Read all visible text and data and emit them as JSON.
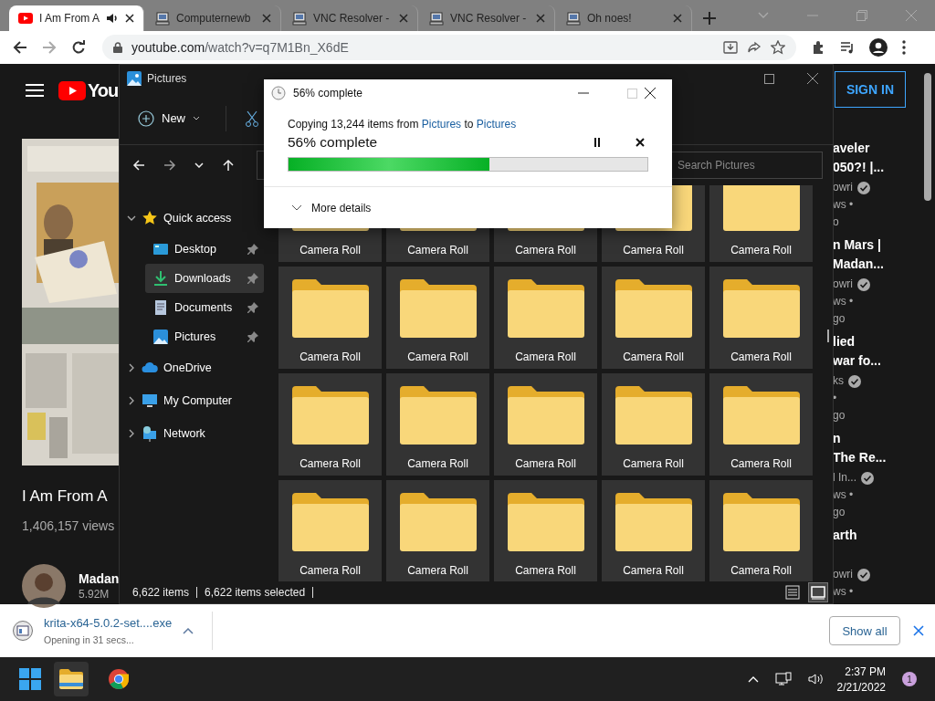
{
  "browser": {
    "tabs": [
      {
        "title": "I Am From A",
        "kind": "youtube",
        "selected": true,
        "audio": true
      },
      {
        "title": "Computernewb",
        "kind": "computer",
        "selected": false,
        "audio": false
      },
      {
        "title": "VNC Resolver -",
        "kind": "computer",
        "selected": false,
        "audio": false
      },
      {
        "title": "VNC Resolver -",
        "kind": "computer",
        "selected": false,
        "audio": false
      },
      {
        "title": "Oh noes!",
        "kind": "computer",
        "selected": false,
        "audio": false
      }
    ],
    "url": {
      "host": "youtube.com",
      "path": "/watch?v=q7M1Bn_X6dE"
    }
  },
  "youtube": {
    "logo_text": "You",
    "sign_in": "SIGN IN",
    "video_title": "I Am From A",
    "views": "1,406,157 views",
    "channel": "Madan",
    "subscribers": "5.92M",
    "recommendations": [
      {
        "title": [
          "aveler",
          "050?! |..."
        ],
        "channel": "owri",
        "verified": true,
        "meta": [
          "ws •",
          "o"
        ]
      },
      {
        "title": [
          "n Mars |",
          "Madan..."
        ],
        "channel": "owri",
        "verified": true,
        "meta": [
          "ws •",
          "go"
        ]
      },
      {
        "title": [
          "lied",
          "war fo..."
        ],
        "channel": "ks",
        "verified": true,
        "meta": [
          "•",
          "go"
        ]
      },
      {
        "title": [
          "n",
          "The Re..."
        ],
        "channel": "l In...",
        "verified": true,
        "meta": [
          "ws •",
          "go"
        ]
      },
      {
        "title": [
          "arth"
        ],
        "channel": "owri",
        "verified": true,
        "meta": [
          "ws •"
        ]
      }
    ]
  },
  "explorer": {
    "title": "Pictures",
    "new_label": "New",
    "search": {
      "placeholder": "Search Pictures"
    },
    "sidebar": [
      {
        "label": "Quick access",
        "kind": "star",
        "expanded": true,
        "children": [
          {
            "label": "Desktop",
            "kind": "desktop",
            "selected": false,
            "pinned": true
          },
          {
            "label": "Downloads",
            "kind": "download",
            "selected": true,
            "pinned": true
          },
          {
            "label": "Documents",
            "kind": "document",
            "selected": false,
            "pinned": true
          },
          {
            "label": "Pictures",
            "kind": "pictures",
            "selected": false,
            "pinned": true
          }
        ]
      },
      {
        "label": "OneDrive",
        "kind": "cloud",
        "expanded": false
      },
      {
        "label": "My Computer",
        "kind": "computer",
        "expanded": false
      },
      {
        "label": "Network",
        "kind": "network",
        "expanded": false
      }
    ],
    "items": [
      {
        "name": "Camera Roll",
        "selected": true
      },
      {
        "name": "Camera Roll",
        "selected": true
      },
      {
        "name": "Camera Roll",
        "selected": true
      },
      {
        "name": "Camera Roll",
        "selected": true
      },
      {
        "name": "Camera Roll",
        "selected": true
      },
      {
        "name": "Camera Roll",
        "selected": true
      },
      {
        "name": "Camera Roll",
        "selected": true
      },
      {
        "name": "Camera Roll",
        "selected": true
      },
      {
        "name": "Camera Roll",
        "selected": true
      },
      {
        "name": "Camera Roll",
        "selected": true
      },
      {
        "name": "Camera Roll",
        "selected": true
      },
      {
        "name": "Camera Roll",
        "selected": true
      },
      {
        "name": "Camera Roll",
        "selected": true
      },
      {
        "name": "Camera Roll",
        "selected": true
      },
      {
        "name": "Camera Roll",
        "selected": true
      },
      {
        "name": "Camera Roll",
        "selected": true
      },
      {
        "name": "Camera Roll",
        "selected": true
      },
      {
        "name": "Camera Roll",
        "selected": true
      },
      {
        "name": "Camera Roll",
        "selected": true
      },
      {
        "name": "Camera Roll",
        "selected": true
      }
    ],
    "status": {
      "count": "6,622 items",
      "selection": "6,622 items selected"
    },
    "views": [
      {
        "kind": "details",
        "selected": false
      },
      {
        "kind": "tiles",
        "selected": true
      }
    ]
  },
  "copy_dialog": {
    "title": "56% complete",
    "message": {
      "prefix": "Copying 13,244 items from",
      "source": "Pictures",
      "middle": "to",
      "destination": "Pictures"
    },
    "heading": "56% complete",
    "level": 0.56,
    "more_details": "More details"
  },
  "downloads": {
    "file": "krita-x64-5.0.2-set....exe",
    "status": "Opening in 31 secs...",
    "show_all": "Show all"
  },
  "taskbar": {
    "time": "2:37 PM",
    "date": "2/21/2022",
    "notifications": "1"
  }
}
